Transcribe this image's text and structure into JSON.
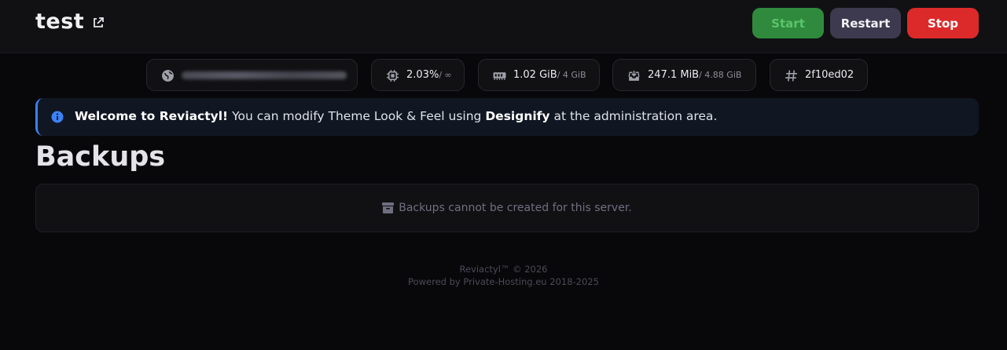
{
  "header": {
    "title": "test",
    "buttons": {
      "start": "Start",
      "restart": "Restart",
      "stop": "Stop"
    }
  },
  "stats": {
    "address": {
      "icon": "globe-icon"
    },
    "cpu": {
      "value": "2.03%",
      "limit": "/ ∞",
      "icon": "cpu-icon"
    },
    "memory": {
      "value": "1.02 GiB",
      "limit": "/ 4 GiB",
      "icon": "memory-icon"
    },
    "disk": {
      "value": "247.1 MiB",
      "limit": "/ 4.88 GiB",
      "icon": "disk-icon"
    },
    "id": {
      "value": "2f10ed02",
      "icon": "hash-icon"
    }
  },
  "alert": {
    "strong": "Welcome to Reviactyl!",
    "text": " You can modify Theme Look & Feel using ",
    "strong2": "Designify",
    "text2": " at the administration area."
  },
  "section": {
    "title": "Backups"
  },
  "empty": {
    "message": "Backups cannot be created for this server."
  },
  "footer": {
    "line1": "Reviactyl™ © 2026",
    "line2": "Powered by Private-Hosting.eu 2018-2025"
  },
  "colors": {
    "start": "#2f8a3e",
    "restart": "#3d3a4f",
    "stop": "#dc2a2a",
    "accent": "#3b82f6"
  }
}
